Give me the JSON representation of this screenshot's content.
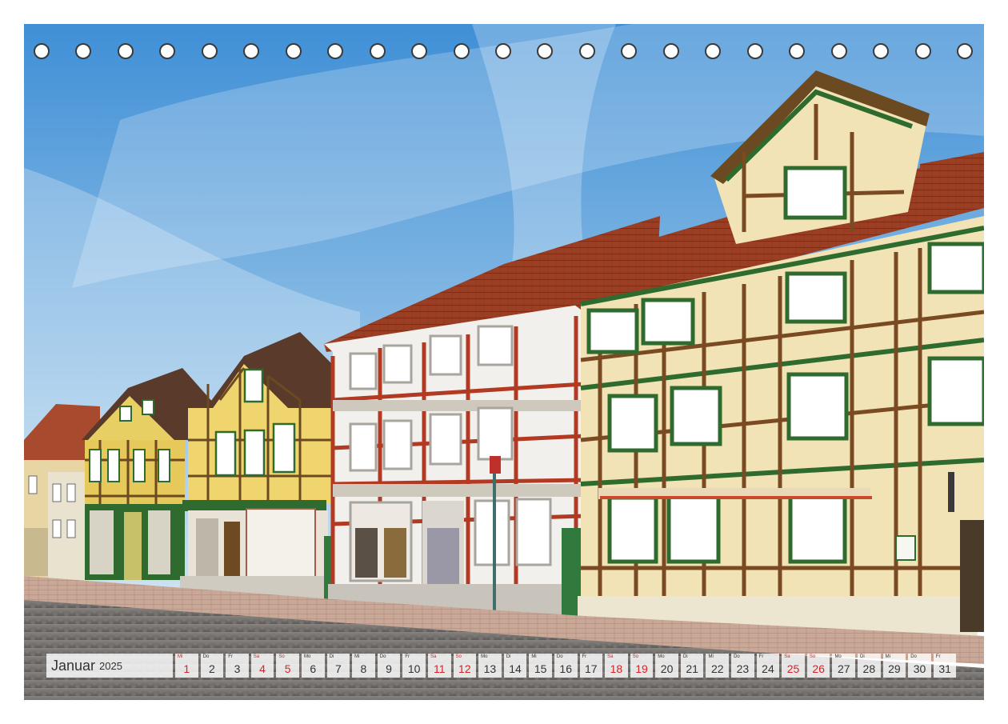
{
  "calendar": {
    "month": "Januar",
    "year": "2025",
    "days": [
      {
        "wd": "Mi",
        "d": "1",
        "red": true
      },
      {
        "wd": "Do",
        "d": "2",
        "red": false
      },
      {
        "wd": "Fr",
        "d": "3",
        "red": false
      },
      {
        "wd": "Sa",
        "d": "4",
        "red": true
      },
      {
        "wd": "So",
        "d": "5",
        "red": true
      },
      {
        "wd": "Mo",
        "d": "6",
        "red": false
      },
      {
        "wd": "Di",
        "d": "7",
        "red": false
      },
      {
        "wd": "Mi",
        "d": "8",
        "red": false
      },
      {
        "wd": "Do",
        "d": "9",
        "red": false
      },
      {
        "wd": "Fr",
        "d": "10",
        "red": false
      },
      {
        "wd": "Sa",
        "d": "11",
        "red": true
      },
      {
        "wd": "So",
        "d": "12",
        "red": true
      },
      {
        "wd": "Mo",
        "d": "13",
        "red": false
      },
      {
        "wd": "Di",
        "d": "14",
        "red": false
      },
      {
        "wd": "Mi",
        "d": "15",
        "red": false
      },
      {
        "wd": "Do",
        "d": "16",
        "red": false
      },
      {
        "wd": "Fr",
        "d": "17",
        "red": false
      },
      {
        "wd": "Sa",
        "d": "18",
        "red": true
      },
      {
        "wd": "So",
        "d": "19",
        "red": true
      },
      {
        "wd": "Mo",
        "d": "20",
        "red": false
      },
      {
        "wd": "Di",
        "d": "21",
        "red": false
      },
      {
        "wd": "Mi",
        "d": "22",
        "red": false
      },
      {
        "wd": "Do",
        "d": "23",
        "red": false
      },
      {
        "wd": "Fr",
        "d": "24",
        "red": false
      },
      {
        "wd": "Sa",
        "d": "25",
        "red": true
      },
      {
        "wd": "So",
        "d": "26",
        "red": true
      },
      {
        "wd": "Mo",
        "d": "27",
        "red": false
      },
      {
        "wd": "Di",
        "d": "28",
        "red": false
      },
      {
        "wd": "Mi",
        "d": "29",
        "red": false
      },
      {
        "wd": "Do",
        "d": "30",
        "red": false
      },
      {
        "wd": "Fr",
        "d": "31",
        "red": false
      }
    ]
  },
  "binding_hole_count": 23,
  "colors": {
    "sky_top": "#3f8fd6",
    "sky_bottom": "#cfe3f2",
    "roof": "#9a3f24",
    "timber_dark": "#7a4a22",
    "infill_cream": "#f1e3b6",
    "trim_green": "#2f6b2e",
    "red_timber": "#b23a22",
    "cobblestone": "#6e6c6a",
    "weekend_red": "#d4232a"
  }
}
